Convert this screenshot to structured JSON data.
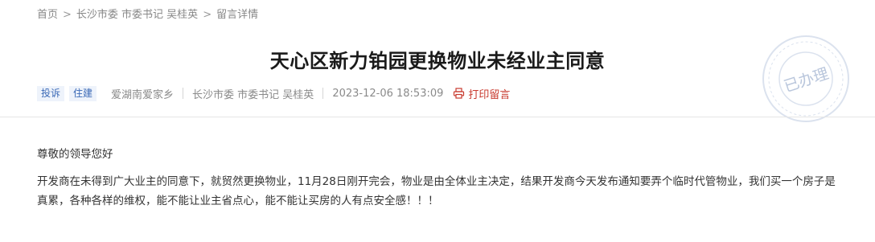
{
  "breadcrumb": {
    "items": [
      "首页",
      "长沙市委 市委书记 吴桂英",
      "留言详情"
    ],
    "separator": ">"
  },
  "title": "天心区新力铂园更换物业未经业主同意",
  "meta": {
    "tags": [
      "投诉",
      "住建"
    ],
    "author": "爱湖南爱家乡",
    "recipient": "长沙市委 市委书记 吴桂英",
    "datetime": "2023-12-06 18:53:09",
    "print_label": "打印留言",
    "print_icon": "printer-icon"
  },
  "stamp": {
    "text": "已办理",
    "color": "#b9c6dc"
  },
  "content": {
    "greeting": "尊敬的领导您好",
    "body": "开发商在未得到广大业主的同意下，就贸然更换物业，11月28日刚开完会，物业是由全体业主决定，结果开发商今天发布通知要弄个临时代管物业，我们买一个房子是真累，各种各样的维权，能不能让业主省点心，能不能让买房的人有点安全感！！！"
  },
  "colors": {
    "accent": "#c83a2e",
    "tag_bg": "#eef3fb",
    "tag_text": "#3c6ab6"
  }
}
